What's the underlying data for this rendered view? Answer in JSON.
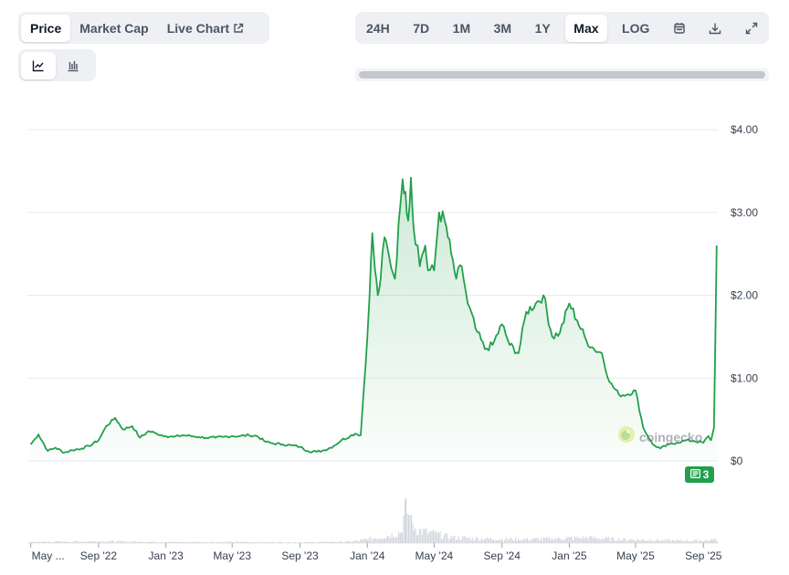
{
  "tabs": [
    {
      "label": "Price",
      "active": true
    },
    {
      "label": "Market Cap",
      "active": false
    },
    {
      "label": "Live Chart",
      "active": false,
      "icon": "external-link-icon"
    }
  ],
  "chart_type_buttons": [
    {
      "icon": "line-chart-icon",
      "active": true
    },
    {
      "icon": "candlestick-icon",
      "active": false
    }
  ],
  "ranges": [
    {
      "label": "24H",
      "active": false
    },
    {
      "label": "7D",
      "active": false
    },
    {
      "label": "1M",
      "active": false
    },
    {
      "label": "3M",
      "active": false
    },
    {
      "label": "1Y",
      "active": false
    },
    {
      "label": "Max",
      "active": true
    },
    {
      "label": "LOG",
      "active": false
    }
  ],
  "toolbar_icons": [
    "calendar-icon",
    "download-icon",
    "expand-icon"
  ],
  "watermark": "coingecko",
  "news_badge": {
    "count": "3",
    "icon": "newspaper-icon"
  },
  "colors": {
    "line": "#22a04b",
    "volume": "#d1d5db",
    "grid": "#e5e7eb",
    "active_bg": "#ffffff",
    "seg_bg": "#eef0f3"
  },
  "chart_data": {
    "type": "area",
    "title": "",
    "xlabel": "",
    "ylabel": "",
    "y_ticks": [
      "$0",
      "$1.00",
      "$2.00",
      "$3.00",
      "$4.00"
    ],
    "ylim": [
      0,
      4
    ],
    "x_ticks": [
      "May ...",
      "Sep '22",
      "Jan '23",
      "May '23",
      "Sep '23",
      "Jan '24",
      "May '24",
      "Sep '24",
      "Jan '25",
      "May '25",
      "Sep '25"
    ],
    "grid": true,
    "series": [
      {
        "x": [
          "2022-05-01",
          "2022-05-15",
          "2022-06-01",
          "2022-06-15",
          "2022-07-01",
          "2022-07-15",
          "2022-08-01",
          "2022-08-15",
          "2022-09-01",
          "2022-09-15",
          "2022-10-01",
          "2022-10-15",
          "2022-11-01",
          "2022-11-15",
          "2022-12-01",
          "2022-12-15",
          "2023-01-01",
          "2023-01-15",
          "2023-02-01",
          "2023-02-15",
          "2023-03-01",
          "2023-03-15",
          "2023-04-01",
          "2023-04-15",
          "2023-05-01",
          "2023-05-15",
          "2023-06-01",
          "2023-06-15",
          "2023-07-01",
          "2023-07-15",
          "2023-08-01",
          "2023-08-15",
          "2023-09-01",
          "2023-09-15",
          "2023-10-01",
          "2023-10-15",
          "2023-11-01",
          "2023-11-15",
          "2023-12-01",
          "2023-12-10",
          "2023-12-20",
          "2024-01-01",
          "2024-01-05",
          "2024-01-10",
          "2024-01-15",
          "2024-01-20",
          "2024-01-25",
          "2024-02-01",
          "2024-02-10",
          "2024-02-20",
          "2024-03-01",
          "2024-03-05",
          "2024-03-10",
          "2024-03-15",
          "2024-03-20",
          "2024-03-25",
          "2024-04-01",
          "2024-04-05",
          "2024-04-10",
          "2024-04-15",
          "2024-04-20",
          "2024-05-01",
          "2024-05-10",
          "2024-05-20",
          "2024-06-01",
          "2024-06-10",
          "2024-06-20",
          "2024-07-01",
          "2024-07-15",
          "2024-08-01",
          "2024-08-15",
          "2024-09-01",
          "2024-09-15",
          "2024-10-01",
          "2024-10-15",
          "2024-11-01",
          "2024-11-15",
          "2024-12-01",
          "2024-12-15",
          "2025-01-01",
          "2025-01-15",
          "2025-02-01",
          "2025-02-15",
          "2025-03-01",
          "2025-03-15",
          "2025-04-01",
          "2025-04-15",
          "2025-05-01",
          "2025-05-15",
          "2025-06-01",
          "2025-06-15",
          "2025-07-01",
          "2025-07-15",
          "2025-08-01",
          "2025-08-15",
          "2025-09-01",
          "2025-09-10",
          "2025-09-15",
          "2025-09-20",
          "2025-09-25"
        ],
        "values": [
          0.2,
          0.32,
          0.12,
          0.16,
          0.1,
          0.13,
          0.15,
          0.18,
          0.25,
          0.42,
          0.52,
          0.38,
          0.42,
          0.28,
          0.36,
          0.33,
          0.3,
          0.29,
          0.31,
          0.3,
          0.29,
          0.28,
          0.28,
          0.29,
          0.3,
          0.3,
          0.31,
          0.3,
          0.23,
          0.21,
          0.2,
          0.19,
          0.17,
          0.12,
          0.11,
          0.13,
          0.18,
          0.25,
          0.3,
          0.33,
          0.31,
          1.5,
          2.0,
          2.75,
          2.3,
          2.0,
          2.2,
          2.7,
          2.45,
          2.2,
          3.1,
          3.4,
          3.25,
          2.9,
          3.42,
          2.8,
          2.6,
          2.35,
          2.5,
          2.6,
          2.3,
          2.3,
          3.0,
          2.9,
          2.5,
          2.2,
          2.35,
          1.9,
          1.6,
          1.35,
          1.4,
          1.65,
          1.4,
          1.3,
          1.8,
          1.9,
          2.0,
          1.5,
          1.55,
          1.9,
          1.7,
          1.45,
          1.35,
          1.3,
          0.95,
          0.8,
          0.8,
          0.85,
          0.4,
          0.2,
          0.15,
          0.2,
          0.22,
          0.25,
          0.24,
          0.22,
          0.3,
          0.25,
          0.4,
          2.6
        ]
      }
    ],
    "volume": {
      "x": [
        "2022-05-01",
        "2022-09-01",
        "2023-01-01",
        "2023-05-01",
        "2023-09-01",
        "2023-12-01",
        "2024-01-01",
        "2024-02-01",
        "2024-03-01",
        "2024-03-10",
        "2024-03-20",
        "2024-04-01",
        "2024-05-01",
        "2024-06-01",
        "2024-08-01",
        "2024-10-01",
        "2024-12-01",
        "2025-02-01",
        "2025-04-01",
        "2025-06-01",
        "2025-08-01",
        "2025-09-15",
        "2025-09-25"
      ],
      "values": [
        0.03,
        0.05,
        0.03,
        0.03,
        0.02,
        0.04,
        0.1,
        0.18,
        0.3,
        1.0,
        0.55,
        0.35,
        0.25,
        0.15,
        0.12,
        0.1,
        0.12,
        0.15,
        0.1,
        0.08,
        0.06,
        0.08,
        0.1
      ]
    }
  }
}
